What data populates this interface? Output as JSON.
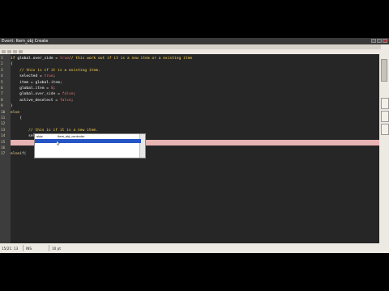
{
  "window": {
    "title": "Event: Item_obj Create"
  },
  "editor": {
    "lines": [
      {
        "num": "1",
        "tokens": [
          {
            "t": "if ",
            "c": "kw"
          },
          {
            "t": "global",
            "c": "var"
          },
          {
            "t": ".",
            "c": "txt"
          },
          {
            "t": "over_side",
            "c": "var"
          },
          {
            "t": " = ",
            "c": "txt"
          },
          {
            "t": "true",
            "c": "tr"
          },
          {
            "t": "// this work out if it is a new item or a existing item",
            "c": "cm"
          }
        ]
      },
      {
        "num": "2",
        "tokens": [
          {
            "t": "{",
            "c": "txt"
          }
        ]
      },
      {
        "num": "3",
        "tokens": [
          {
            "t": "    // this is if it is a existing item.",
            "c": "cm"
          }
        ]
      },
      {
        "num": "4",
        "tokens": [
          {
            "t": "    selected",
            "c": "var"
          },
          {
            "t": " = ",
            "c": "txt"
          },
          {
            "t": "true",
            "c": "tr"
          },
          {
            "t": ";",
            "c": "txt"
          }
        ]
      },
      {
        "num": "5",
        "tokens": [
          {
            "t": "    item",
            "c": "var"
          },
          {
            "t": " = ",
            "c": "txt"
          },
          {
            "t": "global",
            "c": "var"
          },
          {
            "t": ".item;",
            "c": "txt"
          }
        ]
      },
      {
        "num": "6",
        "tokens": [
          {
            "t": "    global",
            "c": "var"
          },
          {
            "t": ".item = ",
            "c": "txt"
          },
          {
            "t": "0",
            "c": "num"
          },
          {
            "t": ";",
            "c": "txt"
          }
        ]
      },
      {
        "num": "7",
        "tokens": [
          {
            "t": "    global",
            "c": "var"
          },
          {
            "t": ".over_side = ",
            "c": "txt"
          },
          {
            "t": "false",
            "c": "tr"
          },
          {
            "t": ";",
            "c": "txt"
          }
        ]
      },
      {
        "num": "8",
        "tokens": [
          {
            "t": "    active_deselect",
            "c": "var"
          },
          {
            "t": " = ",
            "c": "txt"
          },
          {
            "t": "false",
            "c": "tr"
          },
          {
            "t": ";",
            "c": "txt"
          }
        ]
      },
      {
        "num": "9",
        "tokens": [
          {
            "t": "}",
            "c": "txt"
          }
        ]
      },
      {
        "num": "10",
        "tokens": [
          {
            "t": "else",
            "c": "kw"
          }
        ]
      },
      {
        "num": "11",
        "tokens": [
          {
            "t": "    {",
            "c": "txt"
          }
        ]
      },
      {
        "num": "12",
        "tokens": []
      },
      {
        "num": "13",
        "tokens": [
          {
            "t": "        // this is if it is a new item.",
            "c": "cm"
          }
        ]
      },
      {
        "num": "14",
        "tokens": [
          {
            "t": "        selected",
            "c": "var"
          },
          {
            "t": " = ",
            "c": "txt"
          },
          {
            "t": "false",
            "c": "tr"
          },
          {
            "t": ";",
            "c": "txt"
          }
        ]
      },
      {
        "num": "15",
        "tokens": [
          {
            "t": "        ",
            "c": "txt"
          }
        ],
        "highlight": true
      },
      {
        "num": "16",
        "tokens": []
      },
      {
        "num": "17",
        "tokens": [
          {
            "t": "else",
            "c": "kw"
          },
          {
            "t": "if(",
            "c": "txt"
          }
        ]
      }
    ]
  },
  "autocomplete": {
    "items": [
      {
        "type": "obje",
        "name": "item_obj_controler",
        "selected": false
      },
      {
        "type": "",
        "name": "",
        "selected": true
      }
    ]
  },
  "status": {
    "position": "15/21: 13",
    "mode": "INS",
    "font_size": "10 pt"
  }
}
